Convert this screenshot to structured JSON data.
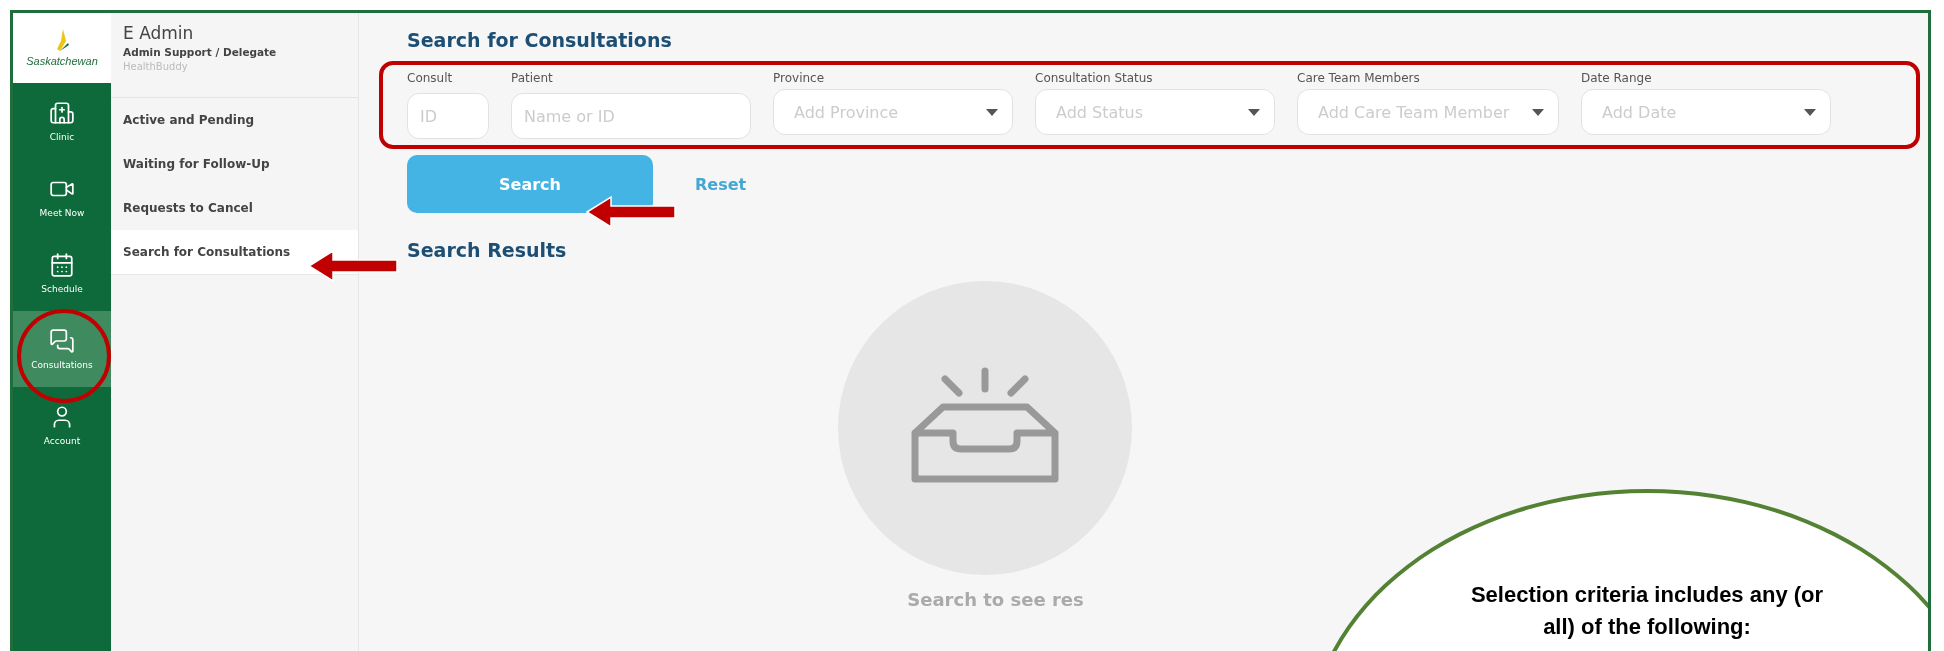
{
  "logo": {
    "text": "Saskatchewan"
  },
  "nav": [
    {
      "label": "Clinic",
      "kind": "clinic",
      "selected": false
    },
    {
      "label": "Meet Now",
      "kind": "video",
      "selected": false
    },
    {
      "label": "Schedule",
      "kind": "calendar",
      "selected": false
    },
    {
      "label": "Consultations",
      "kind": "chat",
      "selected": true
    },
    {
      "label": "Account",
      "kind": "user",
      "selected": false
    }
  ],
  "user": {
    "name": "E Admin",
    "role": "Admin Support / Delegate",
    "app": "HealthBuddy"
  },
  "sidebar": {
    "items": [
      {
        "label": "Active and Pending",
        "selected": false
      },
      {
        "label": "Waiting for Follow-Up",
        "selected": false
      },
      {
        "label": "Requests to Cancel",
        "selected": false
      },
      {
        "label": "Search for Consultations",
        "selected": true
      }
    ]
  },
  "page_title": "Search for Consultations",
  "filters": [
    {
      "label": "Consult",
      "kind": "input",
      "placeholder": "ID"
    },
    {
      "label": "Patient",
      "kind": "input",
      "placeholder": "Name or ID"
    },
    {
      "label": "Province",
      "kind": "select",
      "placeholder": "Add Province"
    },
    {
      "label": "Consultation Status",
      "kind": "select",
      "placeholder": "Add Status"
    },
    {
      "label": "Care Team Members",
      "kind": "select",
      "placeholder": "Add Care Team Member"
    },
    {
      "label": "Date Range",
      "kind": "select",
      "placeholder": "Add Date"
    }
  ],
  "actions": {
    "search": "Search",
    "reset": "Reset"
  },
  "results": {
    "title": "Search Results",
    "empty_text": "Search to see res"
  },
  "callout": {
    "text": "Selection criteria includes any (or all) of the following:"
  }
}
